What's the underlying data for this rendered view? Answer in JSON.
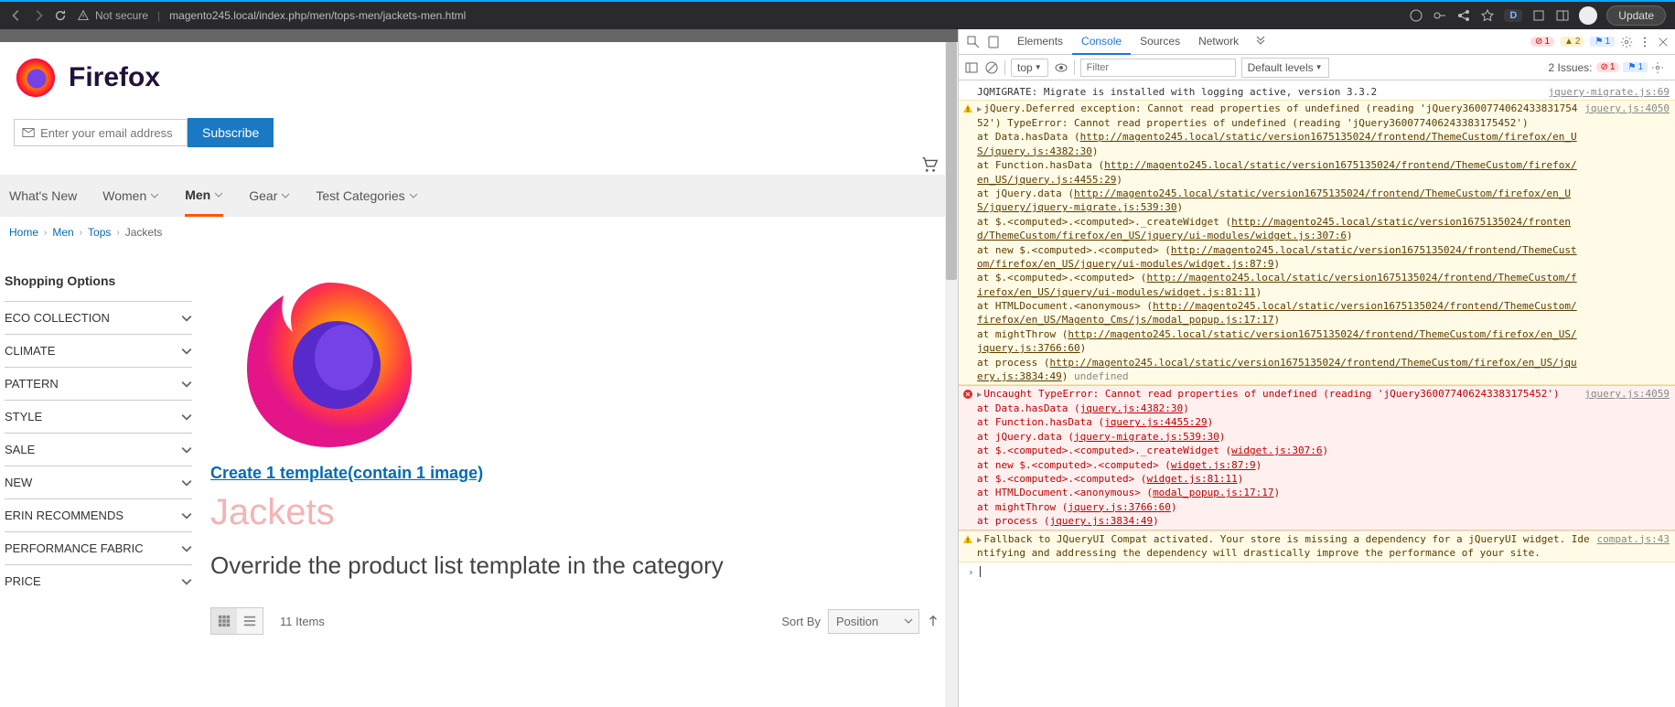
{
  "chrome": {
    "secure_label": "Not secure",
    "url": "magento245.local/index.php/men/tops-men/jackets-men.html",
    "d_badge": "D",
    "update": "Update"
  },
  "page": {
    "logo_text": "Firefox",
    "email_placeholder": "Enter your email address",
    "subscribe": "Subscribe",
    "nav": [
      "What's New",
      "Women",
      "Men",
      "Gear",
      "Test Categories"
    ],
    "nav_has_chevron": [
      false,
      true,
      true,
      true,
      true
    ],
    "active_nav_index": 2,
    "breadcrumb": [
      "Home",
      "Men",
      "Tops",
      "Jackets"
    ],
    "shopping_options": "Shopping Options",
    "filters": [
      "ECO COLLECTION",
      "CLIMATE",
      "PATTERN",
      "STYLE",
      "SALE",
      "NEW",
      "ERIN RECOMMENDS",
      "PERFORMANCE FABRIC",
      "PRICE"
    ],
    "template_link": "Create 1 template(contain 1 image)",
    "title": "Jackets",
    "subtitle": "Override the product list template in the category",
    "item_count": "11 Items",
    "sort_label": "Sort By",
    "sort_value": "Position"
  },
  "devtools": {
    "tabs": [
      "Elements",
      "Console",
      "Sources",
      "Network"
    ],
    "active_tab": 1,
    "err_count": "1",
    "warn_count": "2",
    "flag_count": "1",
    "context": "top",
    "filter_placeholder": "Filter",
    "levels": "Default levels",
    "issues_label": "2 Issues:",
    "issues_err": "1",
    "issues_flag": "1",
    "rows": [
      {
        "type": "info",
        "msg": "JQMIGRATE: Migrate is installed with logging active, version 3.3.2",
        "src": "jquery-migrate.js:69"
      },
      {
        "type": "warn",
        "expand": true,
        "msg_html": "jQuery.Deferred exception: Cannot read properties of undefined (reading 'jQuery360077406243383175452') TypeError: Cannot read properties of undefined (reading 'jQuery360077406243383175452')\n    at Data.hasData (<u>http://magento245.local/static/version1675135024/frontend/ThemeCustom/firefox/en_US/jquery.js:4382:30</u>)\n    at Function.hasData (<u>http://magento245.local/static/version1675135024/frontend/ThemeCustom/firefox/en_US/jquery.js:4455:29</u>)\n    at jQuery.data (<u>http://magento245.local/static/version1675135024/frontend/ThemeCustom/firefox/en_US/jquery/jquery-migrate.js:539:30</u>)\n    at $.<computed>.<computed>._createWidget (<u>http://magento245.local/static/version1675135024/frontend/ThemeCustom/firefox/en_US/jquery/ui-modules/widget.js:307:6</u>)\n    at new $.<computed>.<computed> (<u>http://magento245.local/static/version1675135024/frontend/ThemeCustom/firefox/en_US/jquery/ui-modules/widget.js:87:9</u>)\n    at $.<computed>.<computed> (<u>http://magento245.local/static/version1675135024/frontend/ThemeCustom/firefox/en_US/jquery/ui-modules/widget.js:81:11</u>)\n    at HTMLDocument.<anonymous> (<u>http://magento245.local/static/version1675135024/frontend/ThemeCustom/firefox/en_US/Magento_Cms/js/modal_popup.js:17:17</u>)\n    at mightThrow (<u>http://magento245.local/static/version1675135024/frontend/ThemeCustom/firefox/en_US/jquery.js:3766:60</u>)\n    at process (<u>http://magento245.local/static/version1675135024/frontend/ThemeCustom/firefox/en_US/jquery.js:3834:49</u>) <span class='dt-undef'>undefined</span>",
        "src": "jquery.js:4050"
      },
      {
        "type": "error",
        "expand": true,
        "msg_html": "Uncaught TypeError: Cannot read properties of undefined (reading 'jQuery360077406243383175452')\n    at Data.hasData (<u>jquery.js:4382:30</u>)\n    at Function.hasData (<u>jquery.js:4455:29</u>)\n    at jQuery.data (<u>jquery-migrate.js:539:30</u>)\n    at $.<computed>.<computed>._createWidget (<u>widget.js:307:6</u>)\n    at new $.<computed>.<computed> (<u>widget.js:87:9</u>)\n    at $.<computed>.<computed> (<u>widget.js:81:11</u>)\n    at HTMLDocument.<anonymous> (<u>modal_popup.js:17:17</u>)\n    at mightThrow (<u>jquery.js:3766:60</u>)\n    at process (<u>jquery.js:3834:49</u>)",
        "src": "jquery.js:4059"
      },
      {
        "type": "warn",
        "expand": true,
        "msg_html": "Fallback to JQueryUI Compat activated. Your store is missing a dependency for a jQueryUI widget. Identifying and addressing the dependency will drastically improve the performance of your site.",
        "src": "compat.js:43"
      }
    ]
  }
}
